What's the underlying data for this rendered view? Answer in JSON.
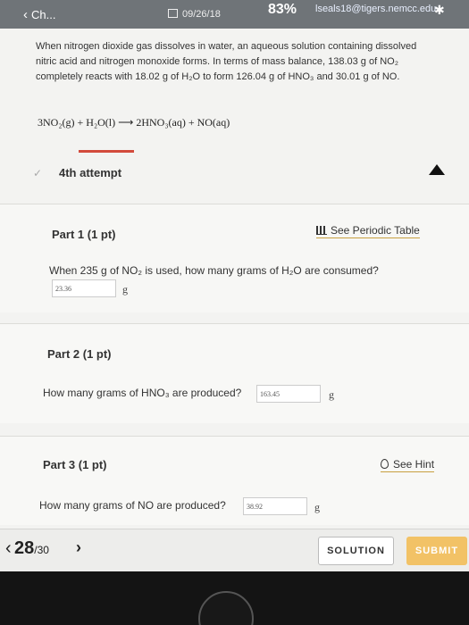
{
  "status": {
    "back_label": "Ch...",
    "date": "09/26/18",
    "battery": "83%",
    "email": "lseals18@tigers.nemcc.edu"
  },
  "problem": {
    "intro": "When nitrogen dioxide gas dissolves in water, an aqueous solution containing dissolved nitric acid and nitrogen monoxide forms. In terms of mass balance, 138.03 g of NO₂ completely reacts with 18.02 g of H₂O to form 126.04 g of HNO₃ and 30.01 g of NO.",
    "equation": "3NO₂(g) + H₂O(l) ⟶ 2HNO₃(aq) + NO(aq)"
  },
  "attempt": {
    "label": "4th attempt"
  },
  "part1": {
    "title": "Part 1 (1 pt)",
    "periodic_link": "See Periodic Table",
    "question": "When 235 g of NO₂ is used, how many grams of H₂O are consumed?",
    "answer": "23.36",
    "unit": "g"
  },
  "part2": {
    "title": "Part 2 (1 pt)",
    "question": "How many grams of HNO₃ are produced?",
    "answer": "163.45",
    "unit": "g"
  },
  "part3": {
    "title": "Part 3 (1 pt)",
    "hint_link": "See Hint",
    "question": "How many grams of NO are produced?",
    "answer": "38.92",
    "unit": "g"
  },
  "nav": {
    "current": "28",
    "total": "/30",
    "solution_label": "SOLUTION",
    "submit_label": "SUBMIT"
  },
  "colors": {
    "accent_red": "#d24b3c",
    "submit_bg": "#f2c266",
    "statusbar_bg": "#6f7478"
  }
}
